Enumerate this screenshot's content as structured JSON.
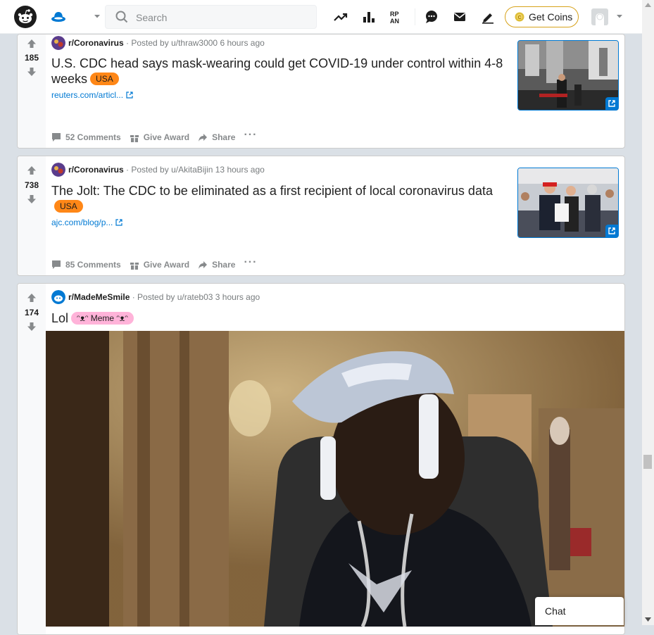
{
  "header": {
    "search_placeholder": "Search",
    "get_coins_label": "Get Coins",
    "icons": [
      "reddit-logo-icon",
      "home-icon",
      "chevron-down-icon",
      "search-icon",
      "trending-icon",
      "stats-icon",
      "rpan-icon",
      "chat-icon",
      "mail-icon",
      "create-post-icon",
      "coin-icon",
      "user-avatar-icon",
      "chevron-down-icon"
    ]
  },
  "posts": [
    {
      "score": "185",
      "subreddit": "r/Coronavirus",
      "posted_by": "· Posted by u/thraw3000 6 hours ago",
      "title": "U.S. CDC head says mask-wearing could get COVID-19 under control within 4-8 weeks",
      "flair": "USA",
      "link": "reuters.com/articl...",
      "comments": "52 Comments",
      "award": "Give Award",
      "share": "Share",
      "more": "···"
    },
    {
      "score": "738",
      "subreddit": "r/Coronavirus",
      "posted_by": "· Posted by u/AkitaBijin 13 hours ago",
      "title": "The Jolt: The CDC to be eliminated as a first recipient of local coronavirus data",
      "flair": "USA",
      "link": "ajc.com/blog/p...",
      "comments": "85 Comments",
      "award": "Give Award",
      "share": "Share",
      "more": "···"
    },
    {
      "score": "174",
      "subreddit": "r/MadeMeSmile",
      "posted_by": "· Posted by u/rateb03 3 hours ago",
      "title": "Lol",
      "flair": "ᵔᴥᵔ Meme ᵔᴥᵔ"
    }
  ],
  "chat": {
    "label": "Chat"
  },
  "colors": {
    "accent": "#0079d3",
    "upvote": "#ff4500",
    "usa_flair": "#ff8717",
    "meme_flair": "#ffb3d9",
    "coins_border": "#d7a21a"
  }
}
